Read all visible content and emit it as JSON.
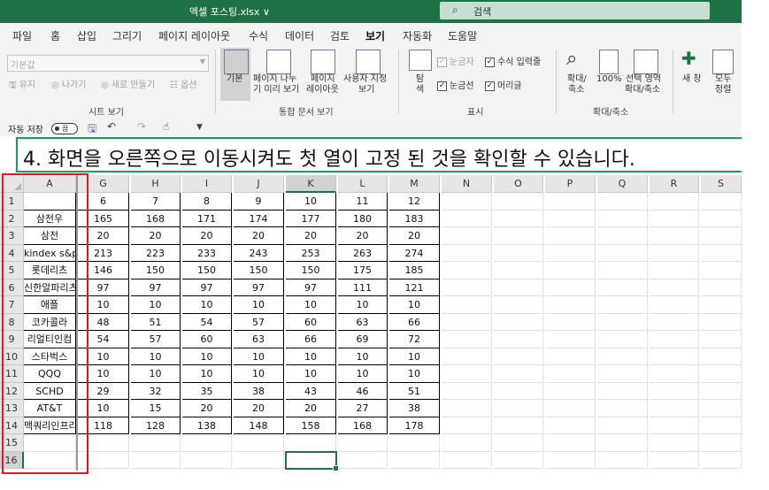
{
  "window": {
    "filename": "엑셀 포스팅.xlsx ∨",
    "search_placeholder": "검색",
    "search_icon": "search-icon"
  },
  "tabs": [
    "파일",
    "홈",
    "삽입",
    "그리기",
    "페이지 레이아웃",
    "수식",
    "데이터",
    "검토",
    "보기",
    "자동화",
    "도움말"
  ],
  "active_tab": "보기",
  "ribbon": {
    "sheet_view": {
      "combo_value": "기본값",
      "keep": "유지",
      "exit": "나가기",
      "new": "새로 만들기",
      "options": "옵션",
      "label": "시트 보기"
    },
    "workbook_views": {
      "normal": "기본",
      "page_break_1": "페이지 나누",
      "page_break_2": "기 미리 보기",
      "page_layout_1": "페이지",
      "page_layout_2": "레이아웃",
      "custom_1": "사용자 지정",
      "custom_2": "보기",
      "label": "통합 문서 보기"
    },
    "show": {
      "navigate_1": "탐",
      "navigate_2": "색",
      "ruler": "눈금자",
      "formula_bar": "수식 입력줄",
      "gridlines": "눈금선",
      "headings": "머리글",
      "label": "표시",
      "ruler_checked": true,
      "formula_bar_checked": true,
      "gridlines_checked": true,
      "headings_checked": true
    },
    "zoom": {
      "zoom_1": "확대/",
      "zoom_2": "축소",
      "hundred": "100%",
      "selection_1": "선택 영역",
      "selection_2": "확대/축소",
      "label": "확대/축소"
    },
    "window": {
      "new_window": "새 창",
      "arrange_1": "모두",
      "arrange_2": "정렬"
    }
  },
  "qat": {
    "autosave_label": "자동 저장",
    "autosave_state": "끔"
  },
  "banner_text": "4. 화면을 오른쪽으로 이동시켜도 첫 열이 고정 된 것을 확인할 수 있습니다.",
  "sheet": {
    "columns": [
      "A",
      "G",
      "H",
      "I",
      "J",
      "K",
      "L",
      "M",
      "N",
      "O",
      "P",
      "Q",
      "R",
      "S"
    ],
    "selected_column": "K",
    "selected_row": "16",
    "row_numbers": [
      "1",
      "2",
      "3",
      "4",
      "5",
      "6",
      "7",
      "8",
      "9",
      "10",
      "11",
      "12",
      "13",
      "14",
      "15",
      "16"
    ],
    "rows": [
      [
        "",
        "6",
        "7",
        "8",
        "9",
        "10",
        "11",
        "12"
      ],
      [
        "삼전우",
        "165",
        "168",
        "171",
        "174",
        "177",
        "180",
        "183"
      ],
      [
        "삼전",
        "20",
        "20",
        "20",
        "20",
        "20",
        "20",
        "20"
      ],
      [
        "kindex s&p",
        "213",
        "223",
        "233",
        "243",
        "253",
        "263",
        "274"
      ],
      [
        "롯데리츠",
        "146",
        "150",
        "150",
        "150",
        "150",
        "175",
        "185"
      ],
      [
        "신한알파리츠",
        "97",
        "97",
        "97",
        "97",
        "97",
        "111",
        "121"
      ],
      [
        "애플",
        "10",
        "10",
        "10",
        "10",
        "10",
        "10",
        "10"
      ],
      [
        "코카콜라",
        "48",
        "51",
        "54",
        "57",
        "60",
        "63",
        "66"
      ],
      [
        "리얼티인컴",
        "54",
        "57",
        "60",
        "63",
        "66",
        "69",
        "72"
      ],
      [
        "스타벅스",
        "10",
        "10",
        "10",
        "10",
        "10",
        "10",
        "10"
      ],
      [
        "QQQ",
        "10",
        "10",
        "10",
        "10",
        "10",
        "10",
        "10"
      ],
      [
        "SCHD",
        "29",
        "32",
        "35",
        "38",
        "43",
        "46",
        "51"
      ],
      [
        "AT&T",
        "10",
        "15",
        "20",
        "20",
        "20",
        "27",
        "38"
      ],
      [
        "맥쿼리인프라",
        "118",
        "128",
        "138",
        "148",
        "158",
        "168",
        "178"
      ]
    ]
  }
}
